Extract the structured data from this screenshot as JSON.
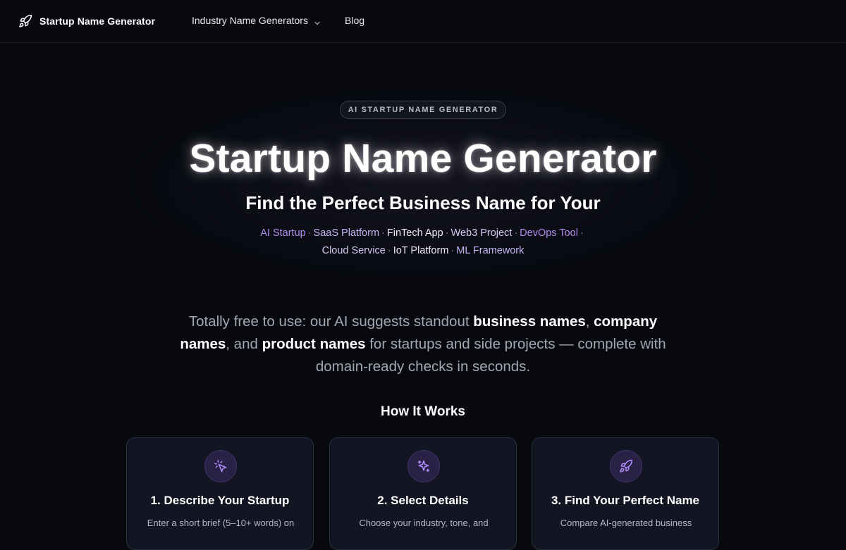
{
  "nav": {
    "brand_label": "Startup Name Generator",
    "brand_icon": "rocket-icon",
    "items": [
      {
        "label": "Industry Name Generators",
        "has_dropdown": true
      },
      {
        "label": "Blog",
        "has_dropdown": false
      }
    ]
  },
  "hero": {
    "badge": "AI STARTUP NAME GENERATOR",
    "title": "Startup Name Generator",
    "subtitle": "Find the Perfect Business Name for Your",
    "tags": [
      "AI Startup",
      "SaaS Platform",
      "FinTech App",
      "Web3 Project",
      "DevOps Tool",
      "Cloud Service",
      "IoT Platform",
      "ML Framework"
    ],
    "separator": "·"
  },
  "description": {
    "part1": "Totally free to use: our AI suggests standout ",
    "bold1": "business names",
    "part2": ", ",
    "bold2": "company names",
    "part3": ", and ",
    "bold3": "product names",
    "part4": " for startups and side projects — complete with domain-ready checks in seconds."
  },
  "how_it_works": {
    "title": "How It Works",
    "steps": [
      {
        "title": "1. Describe Your Startup",
        "text": "Enter a short brief (5–10+ words) on",
        "icon": "cursor-click-icon"
      },
      {
        "title": "2. Select Details",
        "text": "Choose your industry, tone, and",
        "icon": "sparkles-icon"
      },
      {
        "title": "3. Find Your Perfect Name",
        "text": "Compare AI-generated business",
        "icon": "rocket-icon"
      }
    ]
  },
  "colors": {
    "background": "#07090f",
    "accent_purple": "#b08cf0",
    "card_background": "#131622",
    "icon_circle": "#2a2246"
  }
}
